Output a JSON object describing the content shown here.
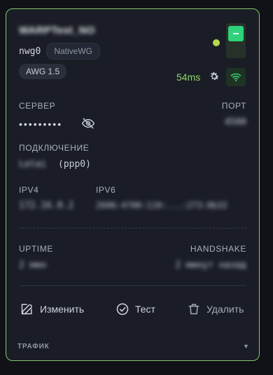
{
  "header": {
    "title": "WARPTest_NO",
    "interface": "nwg0",
    "type_badge": "NativeWG",
    "protocol_badge": "AWG 1.5",
    "ping": "54ms"
  },
  "server": {
    "label": "СЕРВЕР",
    "value_masked": "•••••••••",
    "port_label": "ПОРТ",
    "port_value": "4500"
  },
  "connection": {
    "label": "ПОДКЛЮЧЕНИЕ",
    "name": "Letai",
    "iface": "(ppp0)"
  },
  "addresses": {
    "ipv4_label": "IPV4",
    "ipv4_value": "172.16.0.2",
    "ipv6_label": "IPV6",
    "ipv6_value": "2606:4700:110:...:273:8b32"
  },
  "stats": {
    "uptime_label": "UPTIME",
    "uptime_value": "2 мин",
    "handshake_label": "HANDSHAKE",
    "handshake_value": "2 минут назад"
  },
  "actions": {
    "edit": "Изменить",
    "test": "Тест",
    "delete": "Удалить"
  },
  "traffic": {
    "label": "ТРАФИК",
    "caret": "▼"
  },
  "colors": {
    "accent_green": "#86c66a",
    "status_yellow": "#b6d94a",
    "toggle_on": "#2fd27a",
    "card_bg": "#1a1d26"
  }
}
